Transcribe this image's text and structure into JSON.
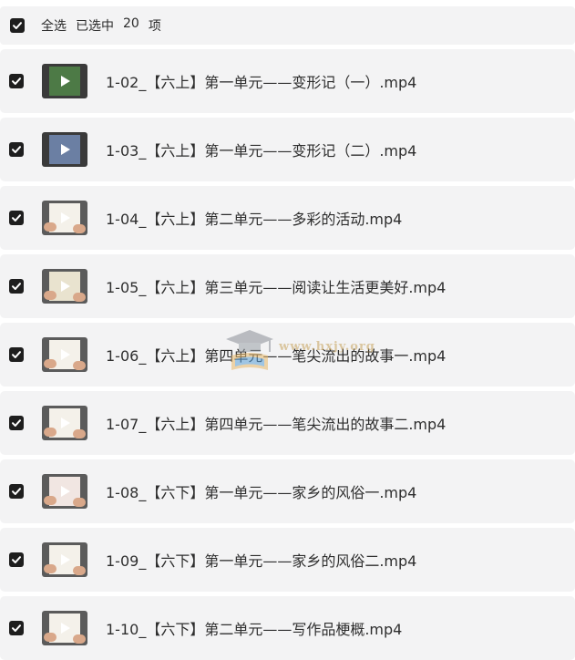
{
  "header": {
    "select_all_label": "全选",
    "selected_prefix": "已选中",
    "selected_count": "20",
    "selected_suffix": "项"
  },
  "files": [
    {
      "name": "1-02_【六上】第一单元——变形记（一）.mp4",
      "thumb": "tablet-outdoor"
    },
    {
      "name": "1-03_【六上】第一单元——变形记（二）.mp4",
      "thumb": "tablet-video"
    },
    {
      "name": "1-04_【六上】第二单元——多彩的活动.mp4",
      "thumb": "paper-writing"
    },
    {
      "name": "1-05_【六上】第三单元——阅读让生活更美好.mp4",
      "thumb": "paper-color"
    },
    {
      "name": "1-06_【六上】第四单元——笔尖流出的故事一.mp4",
      "thumb": "paper-hands"
    },
    {
      "name": "1-07_【六上】第四单元——笔尖流出的故事二.mp4",
      "thumb": "paper-hands"
    },
    {
      "name": "1-08_【六下】第一单元——家乡的风俗一.mp4",
      "thumb": "paper-red"
    },
    {
      "name": "1-09_【六下】第一单元——家乡的风俗二.mp4",
      "thumb": "paper-hands"
    },
    {
      "name": "1-10_【六下】第二单元——写作品梗概.mp4",
      "thumb": "paper-writing"
    }
  ],
  "watermark": {
    "text": "www.hxjy.org",
    "icon": "graduation-cap-book-icon"
  },
  "colors": {
    "row_bg": "#f3f3f4",
    "checkbox": "#1e1e1e",
    "text": "#2e2e2e"
  }
}
